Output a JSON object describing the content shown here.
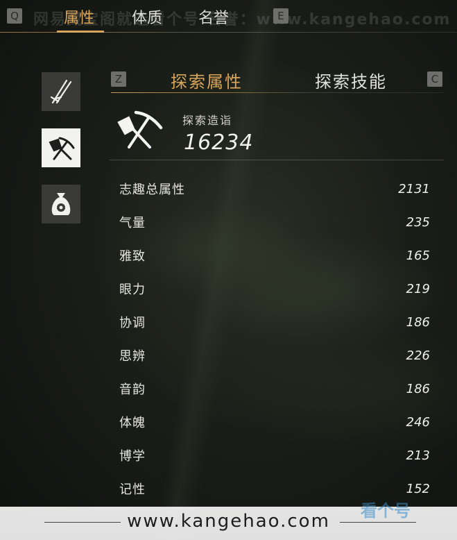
{
  "watermark_top": "网易藏宝阁就选看个号  名誉：www.kangehao.com",
  "top_tabs": {
    "left_key": "Q",
    "right_key": "E",
    "tabs": [
      {
        "label": "属性",
        "active": true
      },
      {
        "label": "体质",
        "active": false
      },
      {
        "label": "名誉",
        "active": false
      }
    ]
  },
  "sidebar": {
    "items": [
      {
        "icon": "sword-icon",
        "active": false
      },
      {
        "icon": "shovel-pickaxe-icon",
        "active": true
      },
      {
        "icon": "money-bag-icon",
        "active": false
      }
    ]
  },
  "sub_tabs": {
    "left_key": "Z",
    "right_key": "C",
    "tabs": [
      {
        "label": "探索属性",
        "active": true
      },
      {
        "label": "探索技能",
        "active": false
      }
    ]
  },
  "header": {
    "icon": "shovel-pickaxe-icon",
    "label": "探索造诣",
    "value": "16234"
  },
  "attributes": [
    {
      "name": "志趣总属性",
      "value": "2131"
    },
    {
      "name": "气量",
      "value": "235"
    },
    {
      "name": "雅致",
      "value": "165"
    },
    {
      "name": "眼力",
      "value": "219"
    },
    {
      "name": "协调",
      "value": "186"
    },
    {
      "name": "思辨",
      "value": "226"
    },
    {
      "name": "音韵",
      "value": "186"
    },
    {
      "name": "体魄",
      "value": "246"
    },
    {
      "name": "博学",
      "value": "213"
    },
    {
      "name": "记性",
      "value": "152"
    }
  ],
  "bottom_watermark": "www.kangehao.com",
  "corner_logo": "看个号",
  "colors": {
    "accent": "#d9a65a",
    "text": "#e6e4de",
    "sidebar_bg": "#3a3a38",
    "sidebar_active_bg": "#f2f2f0"
  }
}
